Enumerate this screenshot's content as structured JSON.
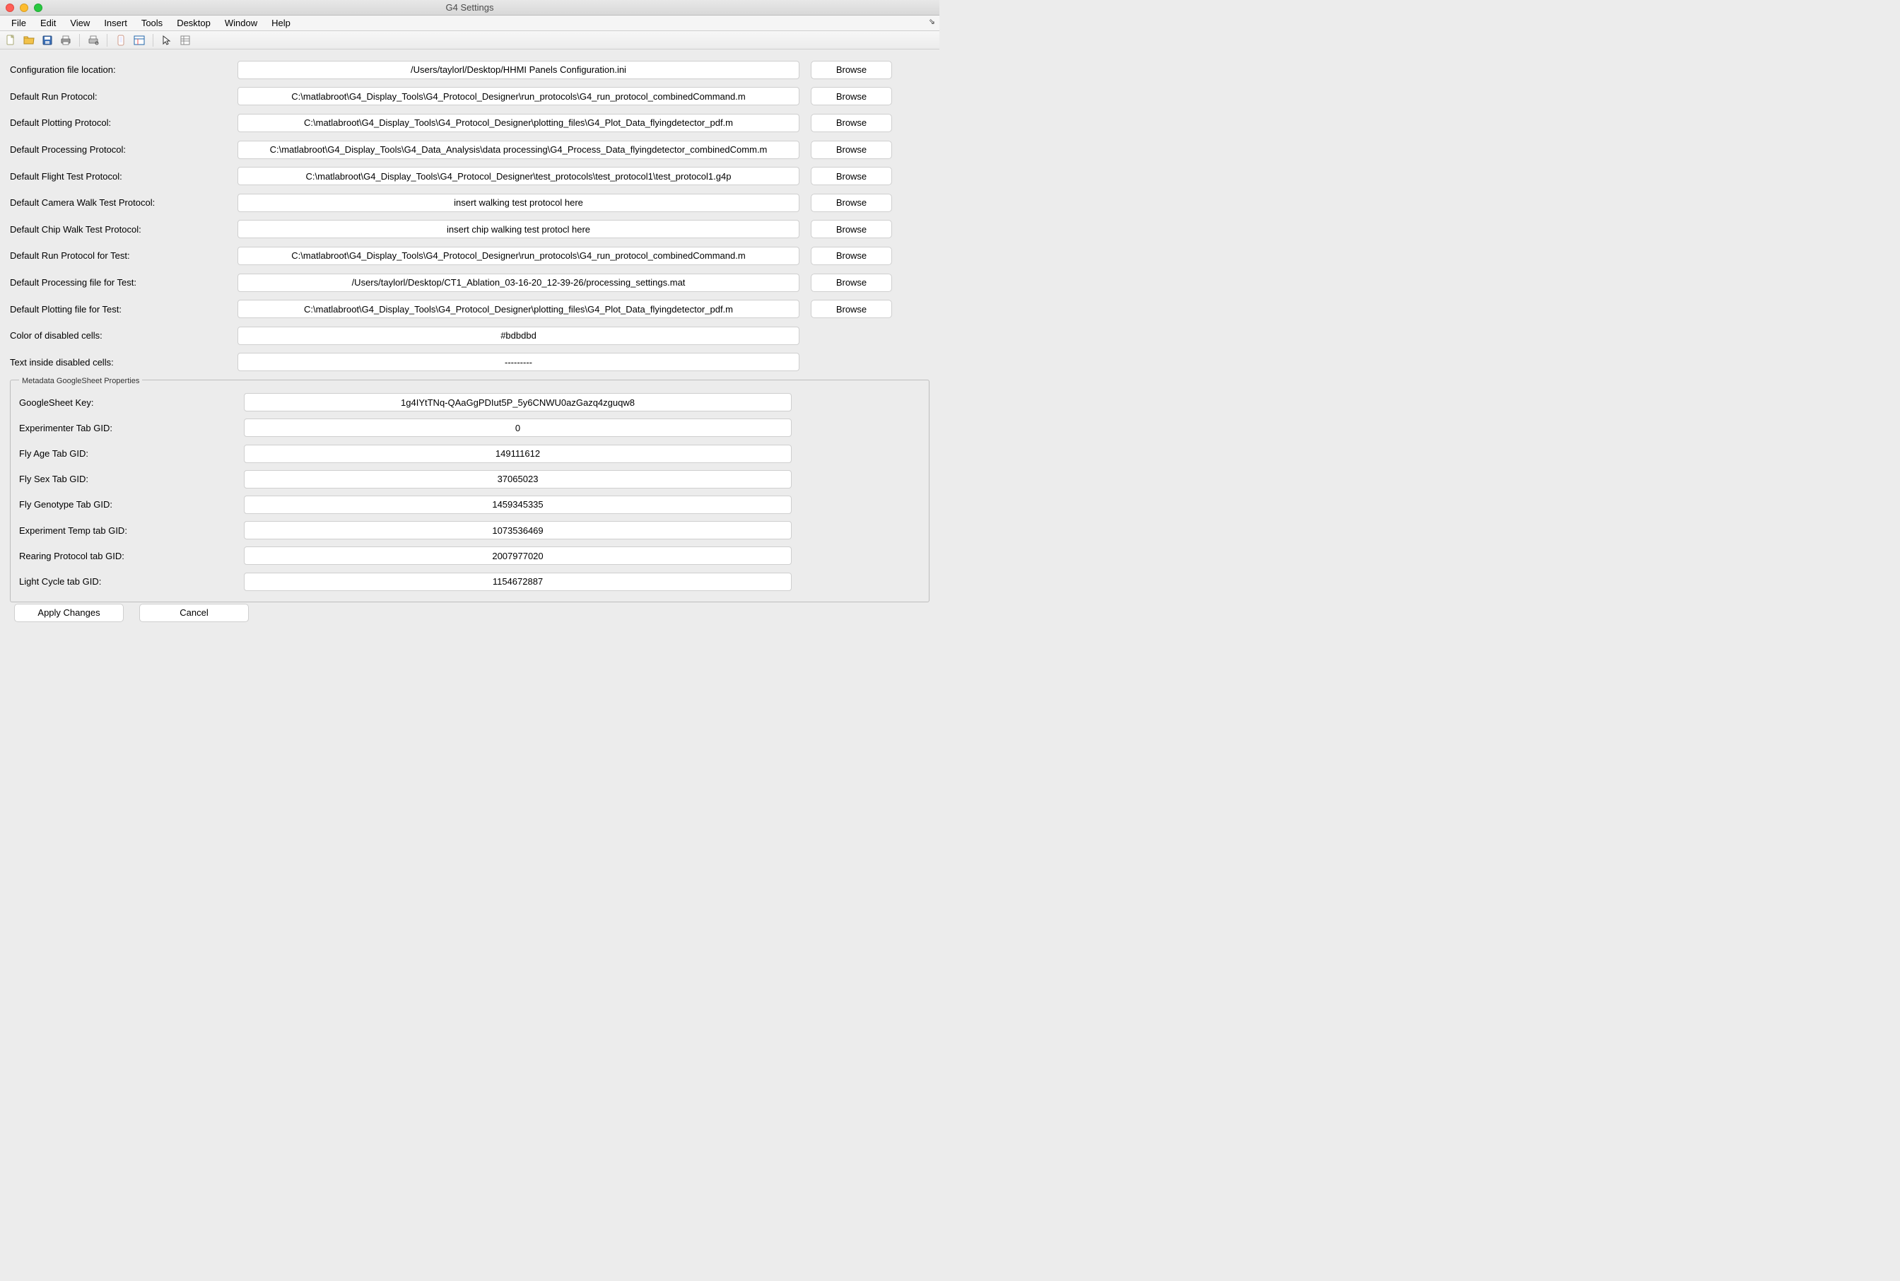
{
  "window": {
    "title": "G4 Settings"
  },
  "menubar": [
    "File",
    "Edit",
    "View",
    "Insert",
    "Tools",
    "Desktop",
    "Window",
    "Help"
  ],
  "toolbar_icons": [
    "new-file-icon",
    "open-folder-icon",
    "save-icon",
    "print-icon",
    "page-setup-icon",
    "mobile-icon",
    "layout-icon",
    "pointer-icon",
    "properties-icon"
  ],
  "browse_label": "Browse",
  "settings_rows": [
    {
      "label": "Configuration file location:",
      "value": "/Users/taylorl/Desktop/HHMI Panels Configuration.ini",
      "browse": true
    },
    {
      "label": "Default Run Protocol:",
      "value": "C:\\matlabroot\\G4_Display_Tools\\G4_Protocol_Designer\\run_protocols\\G4_run_protocol_combinedCommand.m",
      "browse": true
    },
    {
      "label": "Default Plotting Protocol:",
      "value": "C:\\matlabroot\\G4_Display_Tools\\G4_Protocol_Designer\\plotting_files\\G4_Plot_Data_flyingdetector_pdf.m",
      "browse": true
    },
    {
      "label": "Default Processing Protocol:",
      "value": "C:\\matlabroot\\G4_Display_Tools\\G4_Data_Analysis\\data processing\\G4_Process_Data_flyingdetector_combinedComm.m",
      "browse": true
    },
    {
      "label": "Default Flight Test Protocol:",
      "value": "C:\\matlabroot\\G4_Display_Tools\\G4_Protocol_Designer\\test_protocols\\test_protocol1\\test_protocol1.g4p",
      "browse": true
    },
    {
      "label": "Default Camera Walk Test Protocol:",
      "value": "insert walking test protocol here",
      "browse": true
    },
    {
      "label": "Default Chip Walk Test Protocol:",
      "value": "insert chip walking test protocl here",
      "browse": true
    },
    {
      "label": "Default Run Protocol for Test:",
      "value": "C:\\matlabroot\\G4_Display_Tools\\G4_Protocol_Designer\\run_protocols\\G4_run_protocol_combinedCommand.m",
      "browse": true
    },
    {
      "label": "Default Processing file for Test:",
      "value": "/Users/taylorl/Desktop/CT1_Ablation_03-16-20_12-39-26/processing_settings.mat",
      "browse": true
    },
    {
      "label": "Default Plotting file for Test:",
      "value": "C:\\matlabroot\\G4_Display_Tools\\G4_Protocol_Designer\\plotting_files\\G4_Plot_Data_flyingdetector_pdf.m",
      "browse": true
    },
    {
      "label": "Color of disabled cells:",
      "value": "#bdbdbd",
      "browse": false
    },
    {
      "label": "Text inside disabled cells:",
      "value": "---------",
      "browse": false
    }
  ],
  "metadata_legend": "Metadata GoogleSheet Properties",
  "metadata_rows": [
    {
      "label": "GoogleSheet Key:",
      "value": "1g4IYtTNq-QAaGgPDIut5P_5y6CNWU0azGazq4zguqw8"
    },
    {
      "label": "Experimenter Tab GID:",
      "value": "0"
    },
    {
      "label": "Fly Age Tab GID:",
      "value": "149111612"
    },
    {
      "label": "Fly Sex Tab GID:",
      "value": "37065023"
    },
    {
      "label": "Fly Genotype Tab GID:",
      "value": "1459345335"
    },
    {
      "label": "Experiment Temp tab GID:",
      "value": "1073536469"
    },
    {
      "label": "Rearing Protocol tab GID:",
      "value": "2007977020"
    },
    {
      "label": "Light Cycle tab GID:",
      "value": "1154672887"
    }
  ],
  "footer": {
    "apply": "Apply Changes",
    "cancel": "Cancel"
  }
}
